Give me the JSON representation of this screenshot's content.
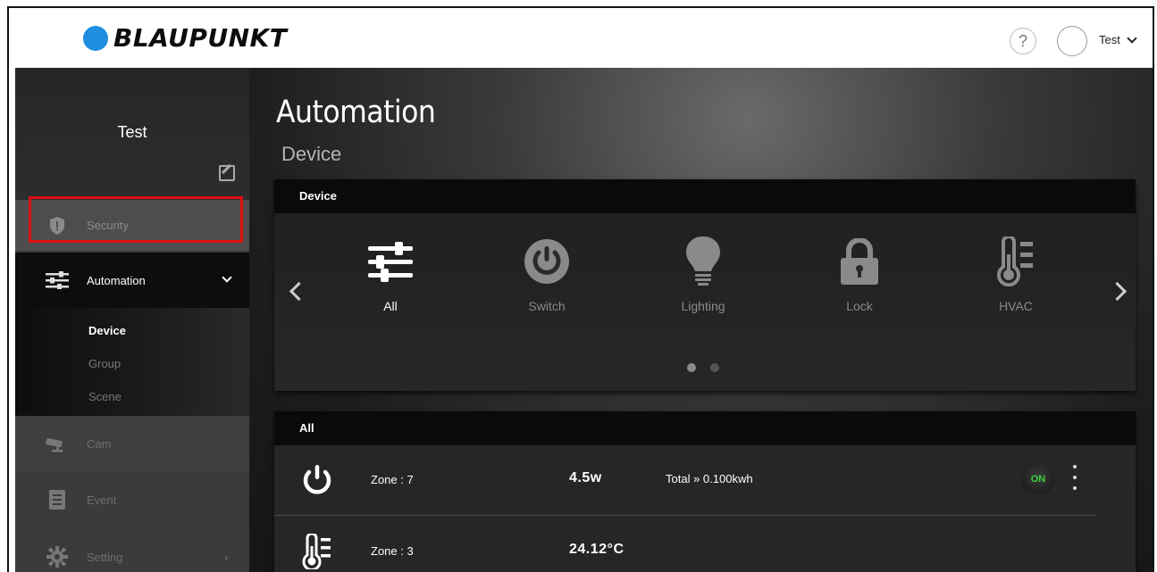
{
  "header": {
    "logo_text": "BLAUPUNKT",
    "help_label": "?",
    "user_name": "Test",
    "brand_color": "#1e8ee0"
  },
  "sidebar": {
    "profile_name": "Test",
    "items": [
      {
        "label": "Security",
        "icon": "shield-icon",
        "state": "disabled"
      },
      {
        "label": "Automation",
        "icon": "sliders-icon",
        "state": "expanded"
      },
      {
        "label": "Cam",
        "icon": "camera-icon",
        "state": "disabled"
      },
      {
        "label": "Event",
        "icon": "event-list-icon",
        "state": "disabled"
      },
      {
        "label": "Setting",
        "icon": "gear-icon",
        "state": "disabled"
      }
    ],
    "sub_items": [
      "Device",
      "Group",
      "Scene"
    ],
    "active_sub": "Device",
    "highlight_color": "#e01010"
  },
  "main": {
    "title": "Automation",
    "subtitle": "Device",
    "device_card": {
      "header": "Device",
      "categories": [
        {
          "label": "All",
          "icon": "sliders-icon",
          "active": true
        },
        {
          "label": "Switch",
          "icon": "power-icon",
          "active": false
        },
        {
          "label": "Lighting",
          "icon": "bulb-icon",
          "active": false
        },
        {
          "label": "Lock",
          "icon": "lock-icon",
          "active": false
        },
        {
          "label": "HVAC",
          "icon": "thermometer-icon",
          "active": false
        }
      ],
      "page_count": 2,
      "current_page": 1
    },
    "list_card": {
      "header": "All",
      "rows": [
        {
          "icon": "power-icon",
          "zone": "Zone : 7",
          "value": "4.5w",
          "total": "Total » 0.100kwh",
          "toggle": "ON"
        },
        {
          "icon": "thermometer-icon",
          "zone": "Zone : 3",
          "value": "24.12°C",
          "total": "",
          "toggle": ""
        }
      ]
    }
  }
}
